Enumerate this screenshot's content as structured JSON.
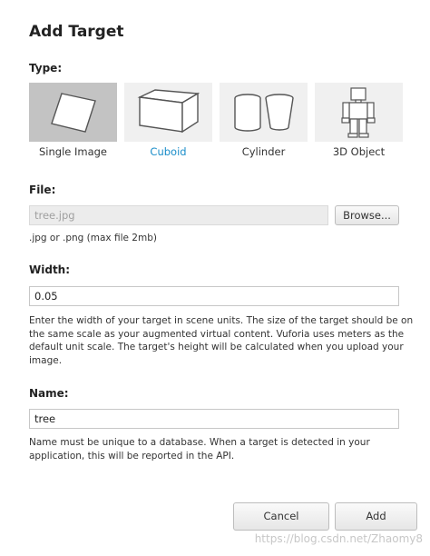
{
  "dialog": {
    "title": "Add Target"
  },
  "type_section": {
    "label": "Type:",
    "options": [
      {
        "label": "Single Image",
        "icon": "single-image-icon",
        "selected": true
      },
      {
        "label": "Cuboid",
        "icon": "cuboid-icon",
        "selected": false
      },
      {
        "label": "Cylinder",
        "icon": "cylinder-icon",
        "selected": false
      },
      {
        "label": "3D Object",
        "icon": "3d-object-icon",
        "selected": false
      }
    ]
  },
  "file_section": {
    "label": "File:",
    "value": "tree.jpg",
    "browse_label": "Browse...",
    "hint": ".jpg or .png (max file 2mb)"
  },
  "width_section": {
    "label": "Width:",
    "value": "0.05",
    "help": "Enter the width of your target in scene units. The size of the target should be on the same scale as your augmented virtual content. Vuforia uses meters as the default unit scale. The target's height will be calculated when you upload your image."
  },
  "name_section": {
    "label": "Name:",
    "value": "tree",
    "help": "Name must be unique to a database. When a target is detected in your application, this will be reported in the API."
  },
  "actions": {
    "cancel_label": "Cancel",
    "add_label": "Add"
  },
  "watermark": "https://blog.csdn.net/Zhaomy8",
  "colors": {
    "selected_tile": "#c3c3c3",
    "tile": "#f0f0f0",
    "link_blue": "#1a8dc9"
  }
}
